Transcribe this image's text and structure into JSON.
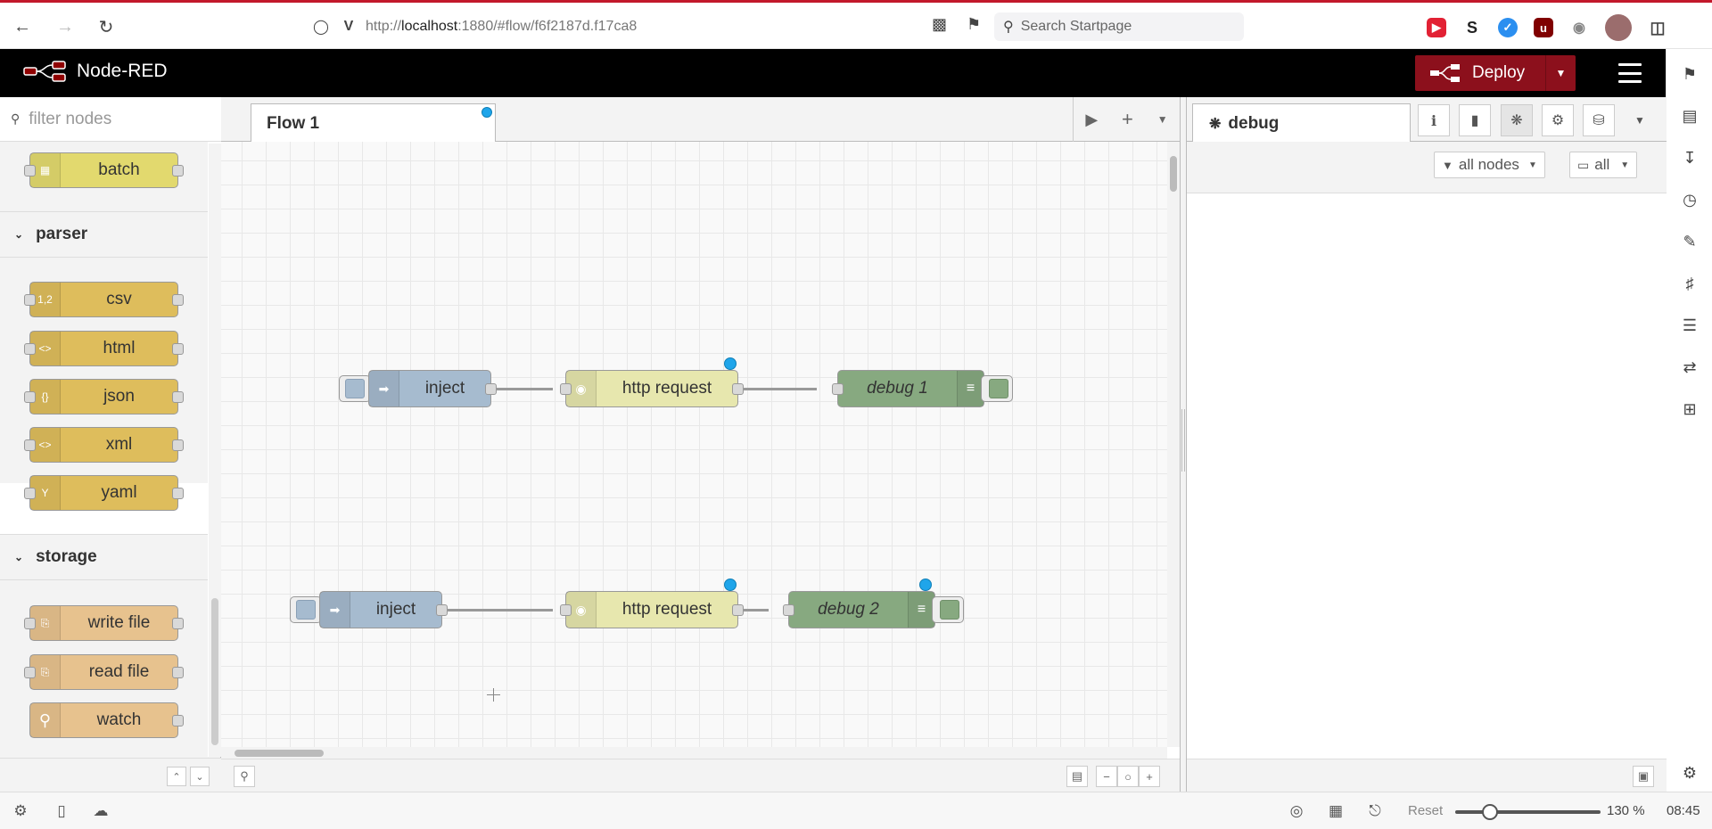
{
  "browser": {
    "url_scheme": "http://",
    "url_host": "localhost",
    "url_rest": ":1880/#flow/f6f2187d.f17ca8",
    "search_placeholder": "Search Startpage"
  },
  "header": {
    "app_title": "Node-RED",
    "deploy_label": "Deploy"
  },
  "palette": {
    "filter_placeholder": "filter nodes",
    "top_nodes": [
      {
        "label": "batch",
        "color": "#e2d96e"
      }
    ],
    "categories": [
      {
        "name": "parser",
        "nodes": [
          {
            "label": "csv",
            "color": "#debd5c"
          },
          {
            "label": "html",
            "color": "#debd5c"
          },
          {
            "label": "json",
            "color": "#debd5c"
          },
          {
            "label": "xml",
            "color": "#debd5c"
          },
          {
            "label": "yaml",
            "color": "#debd5c"
          }
        ]
      },
      {
        "name": "storage",
        "nodes": [
          {
            "label": "write file",
            "color": "#e7c28e"
          },
          {
            "label": "read file",
            "color": "#e7c28e"
          },
          {
            "label": "watch",
            "color": "#e7c28e"
          }
        ]
      }
    ]
  },
  "workspace": {
    "tabs": [
      {
        "label": "Flow 1",
        "changed": true
      }
    ],
    "flows": [
      {
        "inject": "inject",
        "request": "http request",
        "debug": "debug 1"
      },
      {
        "inject": "inject",
        "request": "http request",
        "debug": "debug 2"
      }
    ]
  },
  "sidebar": {
    "active_tab": "debug",
    "filter_nodes": "all nodes",
    "clear_scope": "all"
  },
  "status": {
    "reset_label": "Reset",
    "zoom": "130 %",
    "time": "08:45"
  },
  "colors": {
    "inject": "#a6bbcf",
    "http_request": "#e7e7ae",
    "debug": "#87a980",
    "deploy": "#8c101c",
    "changed_dot": "#1fa5ea"
  }
}
